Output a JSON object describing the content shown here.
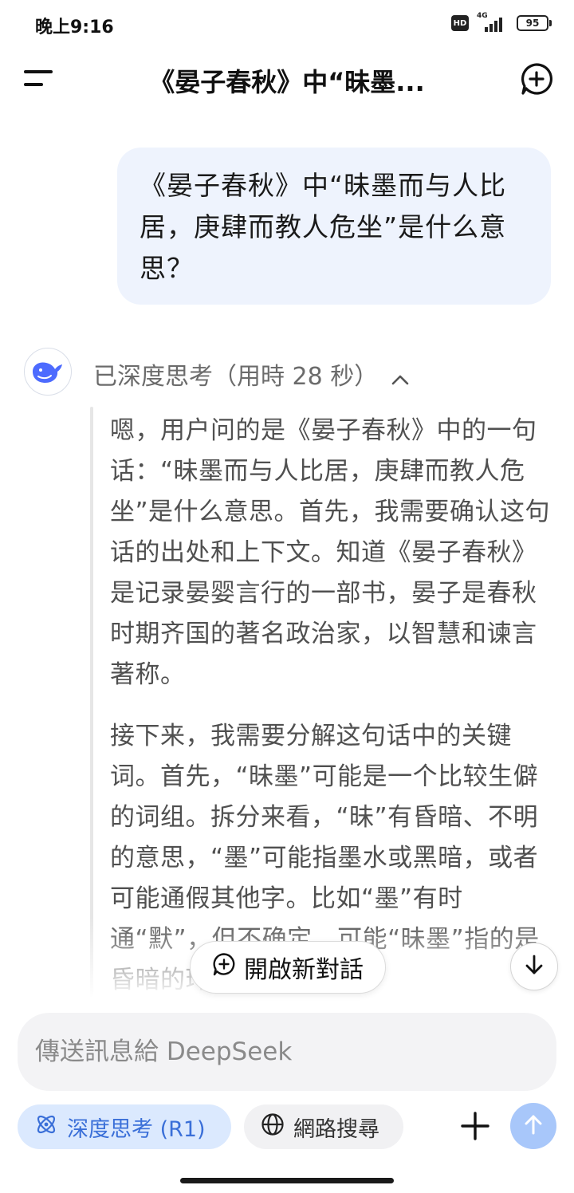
{
  "status_bar": {
    "time": "晚上9:16",
    "hd": "HD",
    "network": "4G",
    "battery": "95"
  },
  "header": {
    "title": "《晏子春秋》中“昧墨..."
  },
  "user_message": {
    "text": "《晏子春秋》中“昧墨而与人比居，庚肆而教人危坐”是什么意思？"
  },
  "assistant": {
    "thinking_label": "已深度思考（用時 28 秒）",
    "paragraphs": [
      "嗯，用户问的是《晏子春秋》中的一句话：“昧墨而与人比居，庚肆而教人危坐”是什么意思。首先，我需要确认这句话的出处和上下文。知道《晏子春秋》是记录晏婴言行的一部书，晏子是春秋时期齐国的著名政治家，以智慧和谏言著称。",
      "接下来，我需要分解这句话中的关键词。首先，“昧墨”可能是一个比较生僻的词组。拆分来看，“昧”有昏暗、不明的意思，“墨”可能指墨水或黑暗，或者可能通假其他字。比如“墨”有时通“默”，但不确定。可能“昧墨”指的是昏暗的环境或行为"
    ]
  },
  "floating": {
    "new_chat_label": "開啟新對話"
  },
  "composer": {
    "placeholder": "傳送訊息給 DeepSeek",
    "value": ""
  },
  "toolbar": {
    "deep_think_label": "深度思考 (R1)",
    "web_search_label": "網路搜尋"
  },
  "colors": {
    "accent": "#3a6fd8",
    "user_bubble": "#eef3fd",
    "chip_active_bg": "#dbe9fe",
    "send_button": "#a8c7fa"
  },
  "icons": {
    "menu": "menu-icon",
    "new_chat": "new-chat-icon",
    "logo": "deepseek-whale-icon",
    "collapse": "chevron-up-icon",
    "scroll_down": "arrow-down-icon",
    "deep_think": "atom-icon",
    "web_search": "globe-icon",
    "attach": "plus-icon",
    "send": "arrow-up-icon"
  }
}
